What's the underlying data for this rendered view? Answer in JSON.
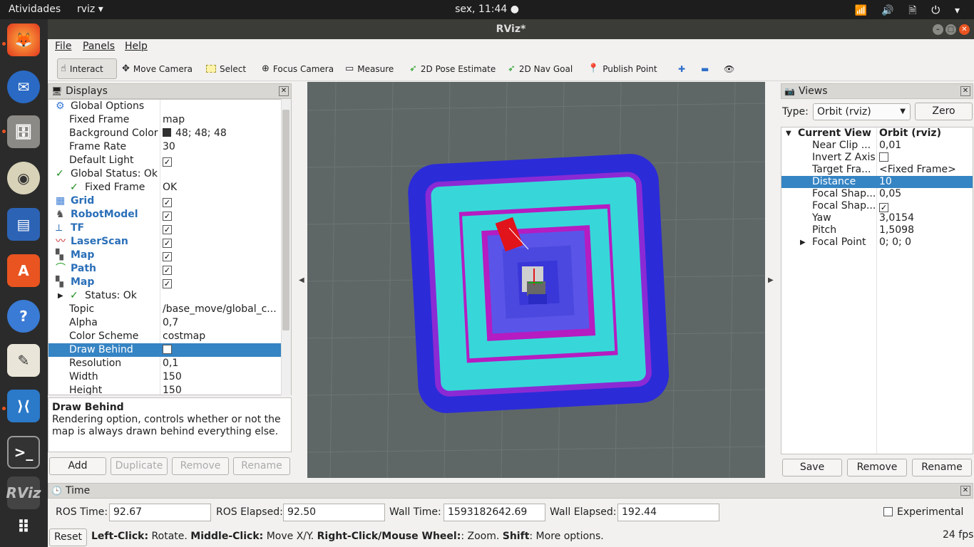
{
  "topbar": {
    "activities": "Atividades",
    "app": "rviz ▾",
    "clock": "sex, 11:44 ●",
    "tray": "📶 🔊 🗎 ⏻ ▾"
  },
  "window": {
    "title": "RViz*"
  },
  "menu": {
    "file": "File",
    "panels": "Panels",
    "help": "Help"
  },
  "toolbar": {
    "interact": "Interact",
    "move_camera": "Move Camera",
    "select": "Select",
    "focus_camera": "Focus Camera",
    "measure": "Measure",
    "pose_estimate": "2D Pose Estimate",
    "nav_goal": "2D Nav Goal",
    "publish_point": "Publish Point",
    "plus": "✚",
    "minus": "▬",
    "eye": "👁"
  },
  "displays": {
    "title": "Displays",
    "rows": [
      {
        "name": "Global Options",
        "value": ""
      },
      {
        "name": "Fixed Frame",
        "value": "map"
      },
      {
        "name": "Background Color",
        "value": "48; 48; 48"
      },
      {
        "name": "Frame Rate",
        "value": "30"
      },
      {
        "name": "Default Light",
        "value": "✓"
      },
      {
        "name": "Global Status: Ok",
        "value": ""
      },
      {
        "name": "Fixed Frame",
        "value": "OK"
      },
      {
        "name": "Grid",
        "value": "✓"
      },
      {
        "name": "RobotModel",
        "value": "✓"
      },
      {
        "name": "TF",
        "value": "✓"
      },
      {
        "name": "LaserScan",
        "value": "✓"
      },
      {
        "name": "Map",
        "value": "✓"
      },
      {
        "name": "Path",
        "value": "✓"
      },
      {
        "name": "Map",
        "value": "✓"
      },
      {
        "name": "Status: Ok",
        "value": ""
      },
      {
        "name": "Topic",
        "value": "/base_move/global_c..."
      },
      {
        "name": "Alpha",
        "value": "0,7"
      },
      {
        "name": "Color Scheme",
        "value": "costmap"
      },
      {
        "name": "Draw Behind",
        "value": ""
      },
      {
        "name": "Resolution",
        "value": "0,1"
      },
      {
        "name": "Width",
        "value": "150"
      },
      {
        "name": "Height",
        "value": "150"
      }
    ],
    "desc_title": "Draw Behind",
    "desc_text": "Rendering option, controls whether or not the map is always drawn behind everything else.",
    "add": "Add",
    "duplicate": "Duplicate",
    "remove": "Remove",
    "rename": "Rename"
  },
  "views": {
    "title": "Views",
    "type_label": "Type:",
    "type_value": "Orbit (rviz)",
    "zero": "Zero",
    "rows": [
      {
        "name": "Current View",
        "value": "Orbit (rviz)"
      },
      {
        "name": "Near Clip ...",
        "value": "0,01"
      },
      {
        "name": "Invert Z Axis",
        "value": ""
      },
      {
        "name": "Target Fra...",
        "value": "<Fixed Frame>"
      },
      {
        "name": "Distance",
        "value": "10"
      },
      {
        "name": "Focal Shap...",
        "value": "0,05"
      },
      {
        "name": "Focal Shap...",
        "value": "✓"
      },
      {
        "name": "Yaw",
        "value": "3,0154"
      },
      {
        "name": "Pitch",
        "value": "1,5098"
      },
      {
        "name": "Focal Point",
        "value": "0; 0; 0"
      }
    ],
    "save": "Save",
    "remove": "Remove",
    "rename": "Rename"
  },
  "time": {
    "title": "Time",
    "ros_time_label": "ROS Time:",
    "ros_time": "92.67",
    "ros_elapsed_label": "ROS Elapsed:",
    "ros_elapsed": "92.50",
    "wall_time_label": "Wall Time:",
    "wall_time": "1593182642.69",
    "wall_elapsed_label": "Wall Elapsed:",
    "wall_elapsed": "192.44",
    "experimental": "Experimental"
  },
  "status": {
    "reset": "Reset",
    "hint_b1": "Left-Click:",
    "hint_1": " Rotate. ",
    "hint_b2": "Middle-Click:",
    "hint_2": " Move X/Y. ",
    "hint_b3": "Right-Click/Mouse Wheel:",
    "hint_3": ": Zoom. ",
    "hint_b4": "Shift",
    "hint_4": ": More options.",
    "fps": "24 fps"
  },
  "colors": {
    "map_blue": "#2c2bd8",
    "map_cyan": "#37d7d9",
    "map_magenta": "#b51cc1",
    "map_inner": "#5a55e8",
    "robot": "#e0141a"
  }
}
